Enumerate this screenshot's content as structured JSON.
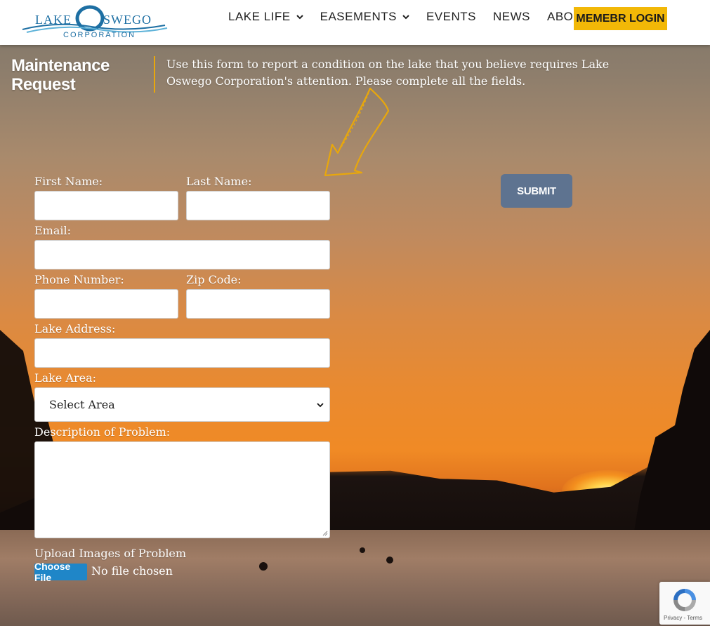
{
  "header": {
    "logo": {
      "lake": "LAKE",
      "oswego": "SWEGO",
      "corporation": "CORPORATION"
    },
    "nav": [
      {
        "label": "LAKE LIFE",
        "dropdown": true
      },
      {
        "label": "EASEMENTS",
        "dropdown": true
      },
      {
        "label": "EVENTS",
        "dropdown": false
      },
      {
        "label": "NEWS",
        "dropdown": false
      },
      {
        "label": "ABOUT",
        "dropdown": true
      }
    ],
    "login_label": "MEMEBR LOGIN"
  },
  "intro": {
    "title_line1": "Maintenance",
    "title_line2": "Request",
    "text": "Use this form to report a condition on the lake that you believe requires Lake Oswego Corporation's attention. Please complete all the fields."
  },
  "form": {
    "first_name_label": "First Name:",
    "last_name_label": "Last Name:",
    "email_label": "Email:",
    "phone_label": "Phone Number:",
    "zip_label": "Zip Code:",
    "lake_address_label": "Lake Address:",
    "lake_area_label": "Lake Area:",
    "lake_area_selected": "Select Area",
    "description_label": "Description of Problem:",
    "upload_label": "Upload Images of Problem",
    "choose_file_label": "Choose File",
    "no_file_text": "No file chosen",
    "submit_label": "SUBMIT"
  },
  "recaptcha": {
    "footer": "Privacy - Terms"
  },
  "colors": {
    "accent": "#f2b807",
    "submit": "#5e7390",
    "choose_file": "#1f86c8",
    "divider": "#e8a70c"
  }
}
